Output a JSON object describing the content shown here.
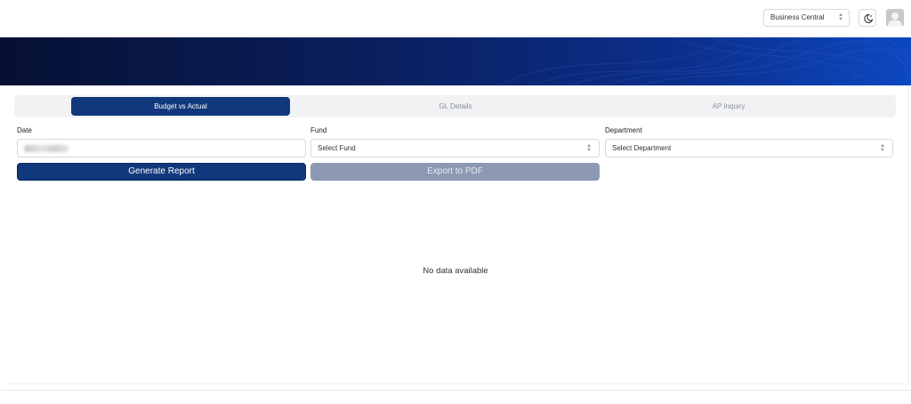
{
  "header": {
    "environment_select": "Business Central",
    "theme_toggle_icon": "moon-sun-icon",
    "avatar_icon": "user-avatar-icon"
  },
  "tabs": [
    {
      "label": "Budget vs Actual",
      "active": true
    },
    {
      "label": "GL Details",
      "active": false
    },
    {
      "label": "AP Inquiry",
      "active": false
    }
  ],
  "form": {
    "date_label": "Date",
    "date_value": "",
    "fund_label": "Fund",
    "fund_placeholder": "Select Fund",
    "department_label": "Department",
    "department_placeholder": "Select Department"
  },
  "actions": {
    "generate_label": "Generate Report",
    "export_label": "Export to PDF"
  },
  "content": {
    "empty_message": "No data available"
  },
  "colors": {
    "primary": "#11387c",
    "disabled": "#8d98b3",
    "banner_dark": "#061033",
    "banner_light": "#0d48c0"
  }
}
